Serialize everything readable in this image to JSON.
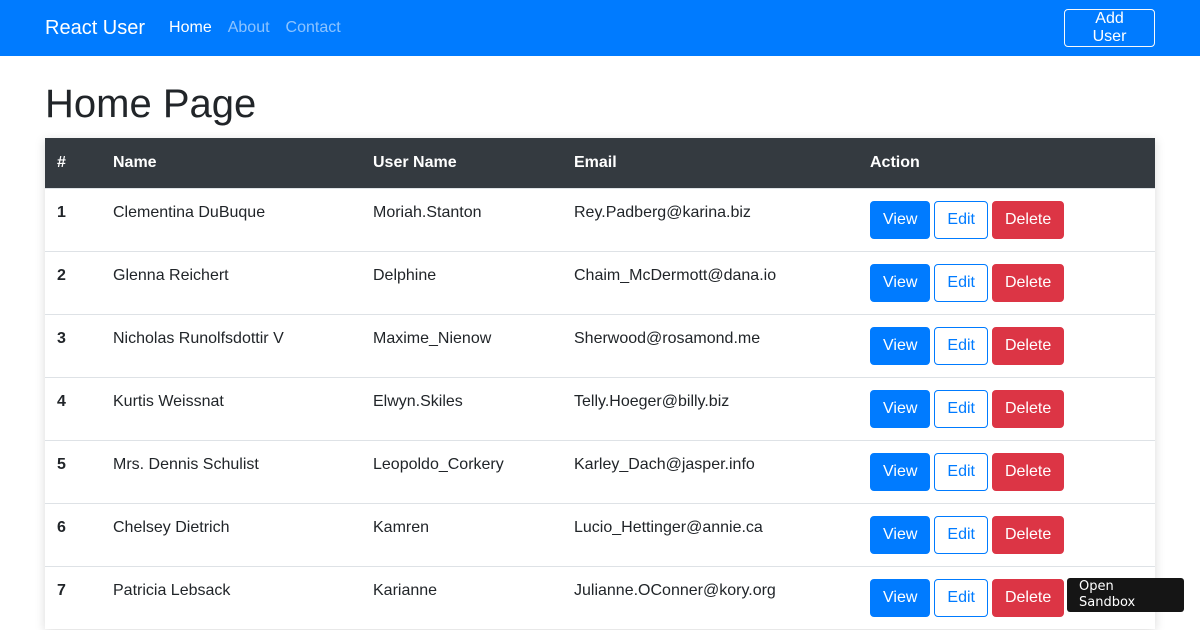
{
  "navbar": {
    "brand": "React User",
    "links": [
      {
        "label": "Home"
      },
      {
        "label": "About"
      },
      {
        "label": "Contact"
      }
    ],
    "add_user_label": "Add User"
  },
  "page": {
    "title": "Home Page"
  },
  "table": {
    "headers": [
      "#",
      "Name",
      "User Name",
      "Email",
      "Action"
    ],
    "actions": {
      "view": "View",
      "edit": "Edit",
      "delete": "Delete"
    },
    "rows": [
      {
        "id": "1",
        "name": "Clementina DuBuque",
        "username": "Moriah.Stanton",
        "email": "Rey.Padberg@karina.biz"
      },
      {
        "id": "2",
        "name": "Glenna Reichert",
        "username": "Delphine",
        "email": "Chaim_McDermott@dana.io"
      },
      {
        "id": "3",
        "name": "Nicholas Runolfsdottir V",
        "username": "Maxime_Nienow",
        "email": "Sherwood@rosamond.me"
      },
      {
        "id": "4",
        "name": "Kurtis Weissnat",
        "username": "Elwyn.Skiles",
        "email": "Telly.Hoeger@billy.biz"
      },
      {
        "id": "5",
        "name": "Mrs. Dennis Schulist",
        "username": "Leopoldo_Corkery",
        "email": "Karley_Dach@jasper.info"
      },
      {
        "id": "6",
        "name": "Chelsey Dietrich",
        "username": "Kamren",
        "email": "Lucio_Hettinger@annie.ca"
      },
      {
        "id": "7",
        "name": "Patricia Lebsack",
        "username": "Karianne",
        "email": "Julianne.OConner@kory.org"
      }
    ]
  },
  "sandbox": {
    "label": "Open Sandbox"
  },
  "colors": {
    "primary": "#007bff",
    "danger": "#dc3545",
    "table_header": "#343a40"
  }
}
